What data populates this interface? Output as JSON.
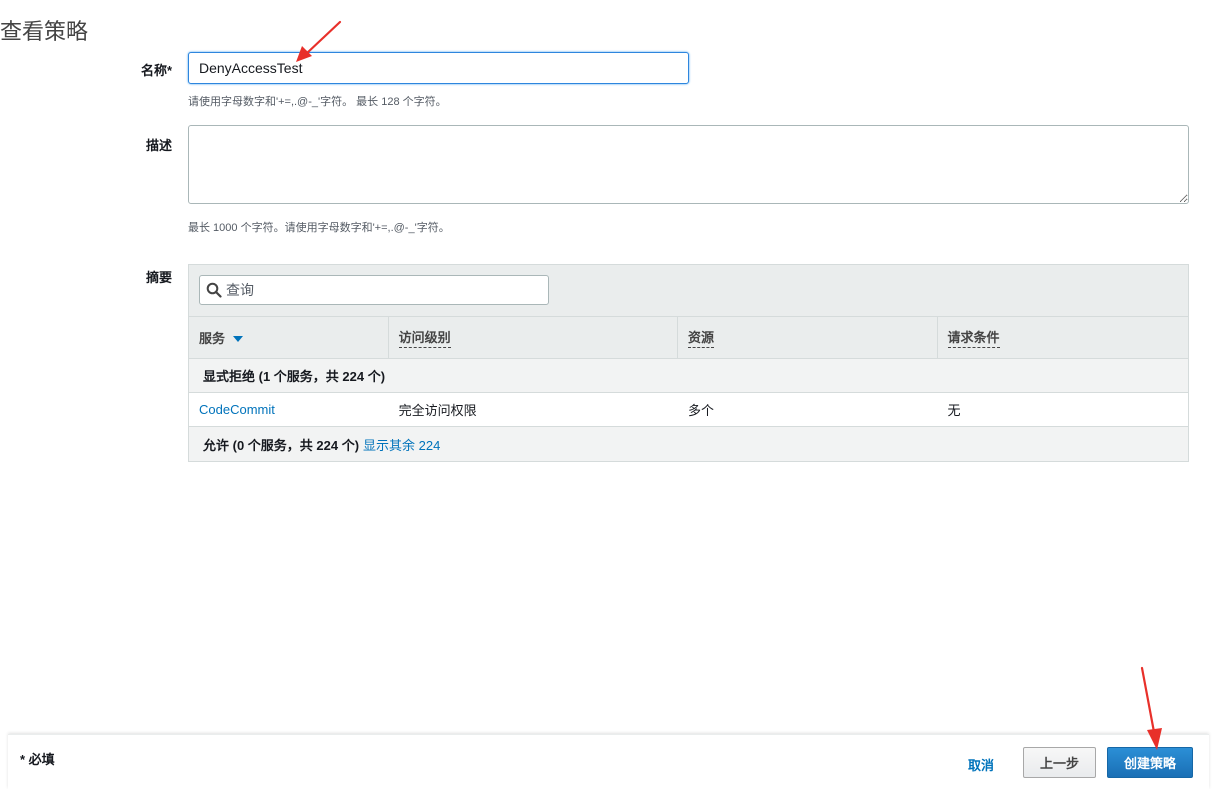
{
  "page": {
    "title": "查看策略"
  },
  "name_field": {
    "label": "名称*",
    "value": "DenyAccessTest",
    "hint": "请使用字母数字和'+=,.@-_'字符。 最长 128 个字符。"
  },
  "description_field": {
    "label": "描述",
    "value": "",
    "hint": "最长 1000 个字符。请使用字母数字和'+=,.@-_'字符。"
  },
  "summary": {
    "label": "摘要",
    "search_placeholder": "查询",
    "columns": [
      "服务",
      "访问级别",
      "资源",
      "请求条件"
    ],
    "deny_group": {
      "label": "显式拒绝 (1 个服务，共 224 个)"
    },
    "rows": [
      {
        "service": "CodeCommit",
        "access_level": "完全访问权限",
        "resource": "多个",
        "condition": "无"
      }
    ],
    "allow_group": {
      "label": "允许 (0 个服务，共 224 个)",
      "link": "显示其余 224"
    }
  },
  "footer": {
    "required_note": "* 必填",
    "cancel_label": "取消",
    "prev_label": "上一步",
    "create_label": "创建策略"
  },
  "colors": {
    "accent": "#0073bb",
    "primary_button": "#1a6fb5",
    "annotation_arrow": "#e8302a"
  },
  "icons": {
    "search": "search-icon",
    "sort": "caret-down-icon",
    "annotation": "arrow-annotation-icon"
  }
}
